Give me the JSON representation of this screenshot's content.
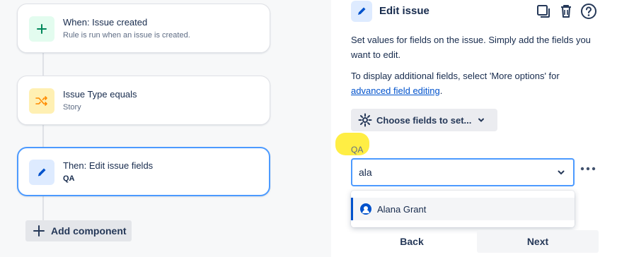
{
  "left": {
    "cards": [
      {
        "title": "When: Issue created",
        "subtitle": "Rule is run when an issue is created.",
        "icon": "plus-icon",
        "icon_bg": "#e3fcef",
        "icon_color": "#00875a"
      },
      {
        "title": "Issue Type equals",
        "subtitle": "Story",
        "icon": "shuffle-icon",
        "icon_bg": "#fff0b3",
        "icon_color": "#ff8b00"
      },
      {
        "title": "Then: Edit issue fields",
        "subtitle": "QA",
        "icon": "pencil-icon",
        "icon_bg": "#deebff",
        "icon_color": "#0052cc"
      }
    ],
    "add_component_label": "Add component"
  },
  "panel": {
    "title": "Edit issue",
    "description1": "Set values for fields on the issue. Simply add the fields you want to edit.",
    "description2_prefix": "To display additional fields, select 'More options' for ",
    "description2_link": "advanced field editing",
    "description2_suffix": ".",
    "choose_fields_label": "Choose fields to set...",
    "field_label": "QA",
    "field_value": "ala",
    "dropdown_options": [
      {
        "label": "Alana Grant",
        "highlighted": true
      }
    ],
    "back_label": "Back",
    "next_label": "Next",
    "accent_color": "#0052cc"
  }
}
